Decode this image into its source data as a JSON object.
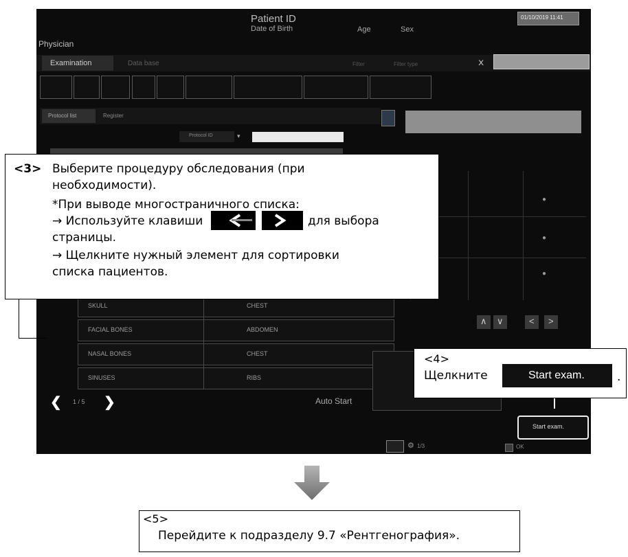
{
  "screen": {
    "header": {
      "patient_id_label": "Patient ID",
      "dob_label": "Date of Birth",
      "age_label": "Age",
      "sex_label": "Sex",
      "datetime": "01/10/2019 11:41",
      "physician_label": "Physician"
    },
    "tabs": {
      "examination": "Examination",
      "database": "Data base"
    },
    "filter_labels": {
      "a": "Filter",
      "b": "Filter type"
    },
    "subtabs": {
      "protocol_list": "Protocol list",
      "register": "Register"
    },
    "search_label": "Protocol ID",
    "left_list": [
      {
        "col1": "SKULL",
        "col2": "CHEST"
      },
      {
        "col1": "FACIAL BONES",
        "col2": "ABDOMEN"
      },
      {
        "col1": "NASAL BONES",
        "col2": "CHEST"
      },
      {
        "col1": "SINUSES",
        "col2": "RIBS"
      }
    ],
    "pager": {
      "prev_icon": "chevron-left-icon",
      "page": "1 / 5",
      "next_icon": "chevron-right-icon"
    },
    "auto_start": "Auto Start",
    "start_exam_button": "Start exam.",
    "count_label": "1/3",
    "ok_label": "OK"
  },
  "callouts": {
    "c3": {
      "num": "<3>",
      "line1": "Выберите процедуру обследования (при",
      "line2": "необходимости).",
      "line3": "*При выводе многостраничного списка:",
      "line4a": "→ Используйте клавиши",
      "line4b": "для выбора",
      "line5": "страницы.",
      "line6": "→ Щелкните нужный элемент для сортировки",
      "line7": "списка пациентов."
    },
    "c4": {
      "num": "<4>",
      "text": "Щелкните",
      "button": "Start exam.",
      "period": "."
    },
    "c5": {
      "num": "<5>",
      "text": "Перейдите к подразделу 9.7 «Рентгенография»."
    }
  }
}
